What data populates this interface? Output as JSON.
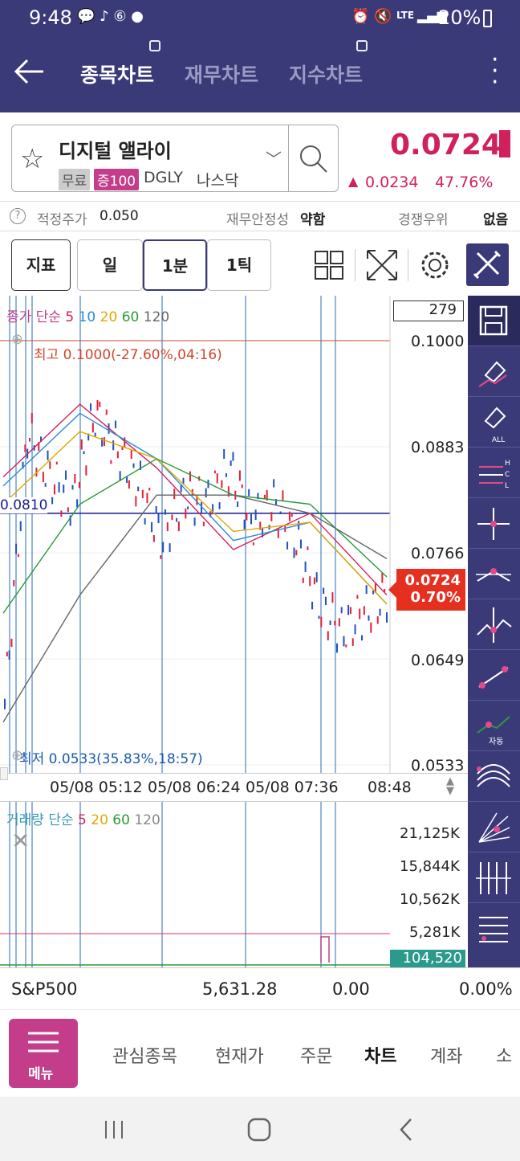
{
  "status_bar": {
    "time": "9:48",
    "battery": "20%",
    "network": "LTE"
  },
  "header": {
    "tabs": [
      {
        "label": "종목차트",
        "active": true
      },
      {
        "label": "재무차트",
        "active": false
      },
      {
        "label": "지수차트",
        "active": false
      }
    ]
  },
  "stock": {
    "name": "디지털 앨라이",
    "tags": [
      "무료",
      "증100"
    ],
    "ticker": "DGLY",
    "market": "나스닥",
    "price": "0.0724",
    "change": "0.0234",
    "change_pct": "47.76%",
    "up_color": "#d0215c"
  },
  "sub_info": {
    "fair_label": "적정주가",
    "fair_value": "0.050",
    "fin_label": "재무안정성",
    "fin_value": "약함",
    "comp_label": "경쟁우위",
    "comp_value": "없음"
  },
  "toolbar": {
    "indicator": "지표",
    "periods": [
      "일",
      "1분",
      "1틱"
    ],
    "selected_period": "1분"
  },
  "chart": {
    "count": "279",
    "price_legend": {
      "prefix": "종가 단순",
      "periods": [
        "5",
        "10",
        "20",
        "60",
        "120"
      ]
    },
    "high_label": "최고 0.1000(-27.60%,04:16)",
    "low_label": "최저 0.0533(35.83%,18:57)",
    "ref_line_label": "0.0810",
    "price_axis": [
      "0.1000",
      "0.0883",
      "0.0766",
      "0.0649",
      "0.0533"
    ],
    "current_price": "0.0724",
    "current_pct": "0.70%",
    "time_axis": [
      "05/08 05:12",
      "05/08 06:24",
      "05/08 07:36",
      "08:48"
    ],
    "volume_legend": {
      "prefix": "거래량 단순",
      "periods": [
        "5",
        "20",
        "60",
        "120"
      ]
    },
    "volume_axis": [
      "21,125K",
      "15,844K",
      "10,562K",
      "5,281K"
    ],
    "current_volume": "104,520",
    "colors": {
      "ma5": "#d0215c",
      "ma10": "#2b8ad6",
      "ma20": "#e0a800",
      "ma60": "#2a9a3a",
      "ma120": "#666666",
      "ref": "#1a1a8c",
      "high": "#d0452b"
    }
  },
  "chart_data": {
    "type": "line",
    "title": "",
    "xlabel": "",
    "ylabel": "",
    "x": [
      "05/08 05:12",
      "05/08 06:24",
      "05/08 07:36",
      "08:48"
    ],
    "ylim": [
      0.0533,
      0.1
    ],
    "series": [
      {
        "name": "5",
        "values": [
          0.085,
          0.093,
          0.086,
          0.077,
          0.081,
          0.072
        ]
      },
      {
        "name": "10",
        "values": [
          0.084,
          0.092,
          0.087,
          0.078,
          0.08,
          0.071
        ]
      },
      {
        "name": "20",
        "values": [
          0.082,
          0.09,
          0.087,
          0.079,
          0.08,
          0.071
        ]
      },
      {
        "name": "60",
        "values": [
          0.07,
          0.082,
          0.087,
          0.083,
          0.082,
          0.074
        ]
      },
      {
        "name": "120",
        "values": [
          0.058,
          0.072,
          0.083,
          0.083,
          0.081,
          0.076
        ]
      }
    ]
  },
  "index_bar": {
    "name": "S&P500",
    "value": "5,631.28",
    "change": "0.00",
    "pct": "0.00%"
  },
  "bottom_nav": {
    "menu_label": "메뉴",
    "items": [
      "관심종목",
      "현재가",
      "주문",
      "차트",
      "계좌",
      "소"
    ],
    "active": "차트"
  }
}
